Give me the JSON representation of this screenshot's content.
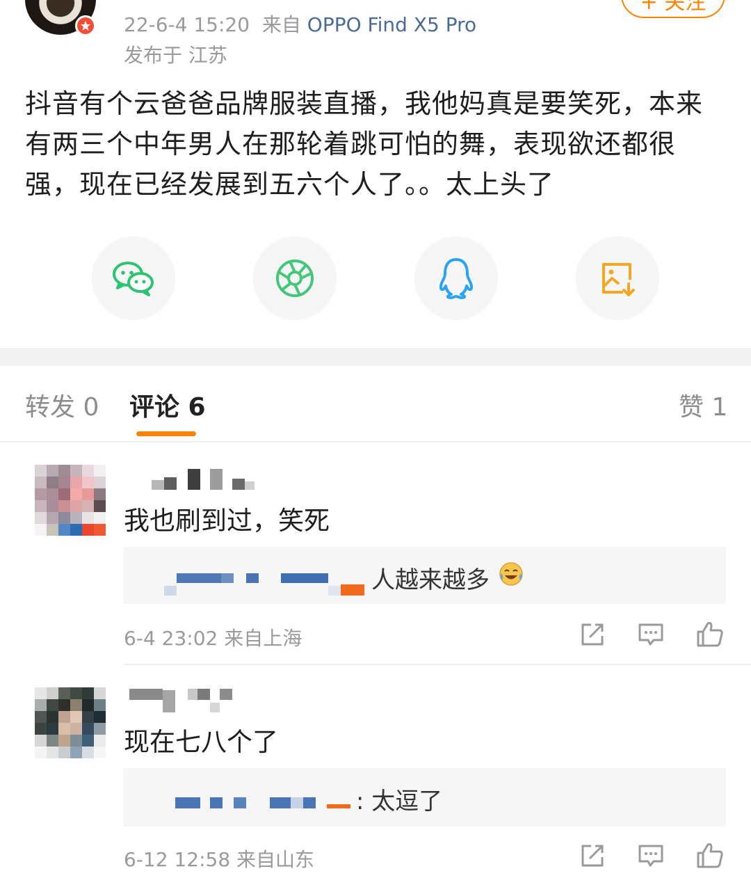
{
  "post": {
    "follow_label": "+ 关注",
    "timestamp": "22-6-4 15:20",
    "source_prefix": "来自",
    "device": "OPPO Find X5 Pro",
    "location": "发布于 江苏",
    "text": "抖音有个云爸爸品牌服装直播，我他妈真是要笑死，本来有两三个中年男人在那轮着跳可怕的舞，表现欲还都很强，现在已经发展到五六个人了。。太上头了"
  },
  "share": {
    "icons": [
      "wechat-icon",
      "moments-icon",
      "qq-icon",
      "save-image-icon"
    ]
  },
  "tabs": {
    "repost": "转发 0",
    "comments": "评论 6",
    "likes": "赞 1"
  },
  "comments": [
    {
      "text": "我也刷到过，笑死",
      "reply_text": "人越来越多",
      "reply_emoji": "laughing-crying-emoji",
      "time": "6-4 23:02",
      "location": "来自上海"
    },
    {
      "text": "现在七八个了",
      "reply_text": ": 太逗了",
      "time": "6-12 12:58",
      "location": "来自山东"
    }
  ],
  "colors": {
    "accent": "#ff8200",
    "link": "#4a6b97",
    "wechat": "#2dc370",
    "moments": "#43c87a",
    "qq": "#2aa4f0",
    "save": "#f5a623",
    "muted": "#9a9a9a"
  }
}
